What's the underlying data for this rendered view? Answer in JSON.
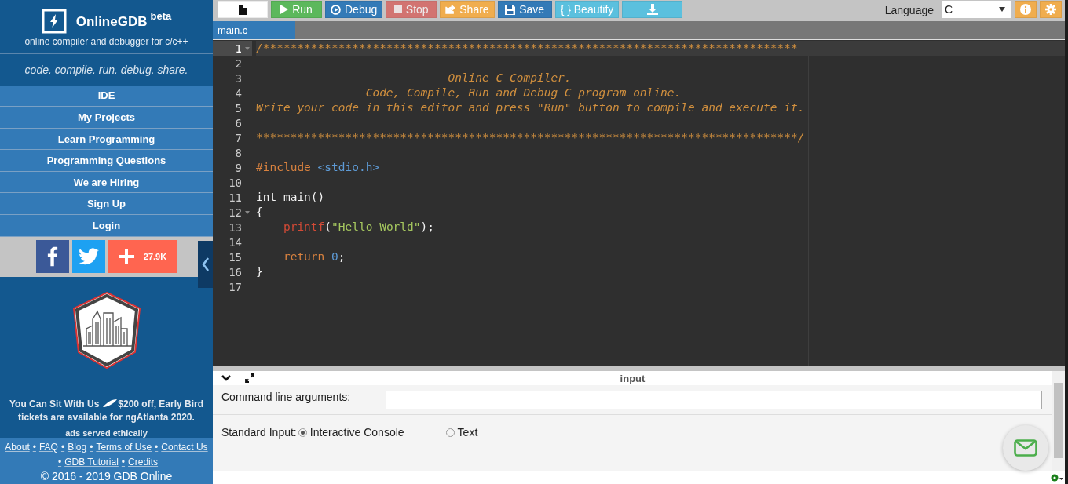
{
  "sidebar": {
    "brand": {
      "name": "OnlineGDB",
      "badge": "beta",
      "subtitle": "online compiler and debugger for c/c++"
    },
    "tagline": "code. compile. run. debug. share.",
    "nav": [
      {
        "label": "IDE"
      },
      {
        "label": "My Projects"
      },
      {
        "label": "Learn Programming"
      },
      {
        "label": "Programming Questions"
      },
      {
        "label": "We are Hiring"
      },
      {
        "label": "Sign Up"
      },
      {
        "label": "Login"
      }
    ],
    "share": [
      {
        "kind": "facebook"
      },
      {
        "kind": "twitter"
      },
      {
        "kind": "addthis",
        "count": "27.9K"
      }
    ],
    "ad": {
      "text_before": "You Can Sit With Us",
      "text_after": "$200 off, Early Bird",
      "text_line2": "tickets are available for ngAtlanta 2020.",
      "note": "ads served ethically"
    },
    "footer": {
      "separator": "•",
      "links": [
        "About",
        "FAQ",
        "Blog",
        "Terms of Use",
        "Contact Us",
        "GDB Tutorial",
        "Credits"
      ],
      "copyright": "© 2016 - 2019 GDB Online"
    }
  },
  "toolbar": {
    "buttons": [
      {
        "kind": "new-file",
        "disabled": false
      },
      {
        "kind": "run",
        "label": "Run",
        "disabled": false
      },
      {
        "kind": "debug",
        "label": "Debug",
        "disabled": false
      },
      {
        "kind": "stop",
        "label": "Stop",
        "disabled": true
      },
      {
        "kind": "share",
        "label": "Share",
        "disabled": false
      },
      {
        "kind": "save",
        "label": "Save",
        "disabled": false
      },
      {
        "kind": "beautify",
        "label": "{ } Beautify",
        "disabled": false
      },
      {
        "kind": "download",
        "disabled": false
      }
    ],
    "language_label": "Language",
    "language": "C"
  },
  "tabs": [
    {
      "label": "main.c",
      "selected": true
    }
  ],
  "editor": {
    "lines": [
      {
        "number": "1",
        "fold": true,
        "active": true,
        "tokens": [
          {
            "kind": "comment",
            "text": "/******************************************************************************"
          }
        ]
      },
      {
        "number": "2",
        "fold": false,
        "active": false
      },
      {
        "number": "3",
        "fold": false,
        "active": false,
        "tokens": [
          {
            "kind": "comment",
            "text": "                            Online C Compiler."
          }
        ]
      },
      {
        "number": "4",
        "fold": false,
        "active": false,
        "tokens": [
          {
            "kind": "comment",
            "text": "                Code, Compile, Run and Debug C program online."
          }
        ]
      },
      {
        "number": "5",
        "fold": false,
        "active": false,
        "tokens": [
          {
            "kind": "comment",
            "text": "Write your code in this editor and press \"Run\" button to compile and execute it."
          }
        ]
      },
      {
        "number": "6",
        "fold": false,
        "active": false
      },
      {
        "number": "7",
        "fold": false,
        "active": false,
        "tokens": [
          {
            "kind": "comment",
            "text": "*******************************************************************************/"
          }
        ]
      },
      {
        "number": "8",
        "fold": false,
        "active": false
      },
      {
        "number": "9",
        "fold": false,
        "active": false,
        "tokens": [
          {
            "kind": "preproc",
            "text": "#include "
          },
          {
            "kind": "header",
            "text": "<stdio.h>"
          }
        ]
      },
      {
        "number": "10",
        "fold": false,
        "active": false
      },
      {
        "number": "11",
        "fold": false,
        "active": false,
        "tokens": [
          {
            "kind": "plain",
            "text": "int main()"
          }
        ]
      },
      {
        "number": "12",
        "fold": true,
        "active": false,
        "tokens": [
          {
            "kind": "plain",
            "text": "{"
          }
        ]
      },
      {
        "number": "13",
        "fold": false,
        "active": false,
        "tokens": [
          {
            "kind": "function",
            "text": "    printf"
          },
          {
            "kind": "plain",
            "text": "("
          },
          {
            "kind": "string",
            "text": "\"Hello World\""
          },
          {
            "kind": "plain",
            "text": ");"
          }
        ]
      },
      {
        "number": "14",
        "fold": false,
        "active": false
      },
      {
        "number": "15",
        "fold": false,
        "active": false,
        "tokens": [
          {
            "kind": "keyword",
            "text": "    return "
          },
          {
            "kind": "number",
            "text": "0"
          },
          {
            "kind": "plain",
            "text": ";"
          }
        ]
      },
      {
        "number": "16",
        "fold": false,
        "active": false,
        "tokens": [
          {
            "kind": "plain",
            "text": "}"
          }
        ]
      },
      {
        "number": "17",
        "fold": false,
        "active": false
      }
    ]
  },
  "input_panel": {
    "title": "input",
    "args_label": "Command line arguments:",
    "stdin_label": "Standard Input:",
    "stdin_options": [
      {
        "label": "Interactive Console",
        "selected": true
      },
      {
        "label": "Text",
        "selected": false
      }
    ]
  }
}
